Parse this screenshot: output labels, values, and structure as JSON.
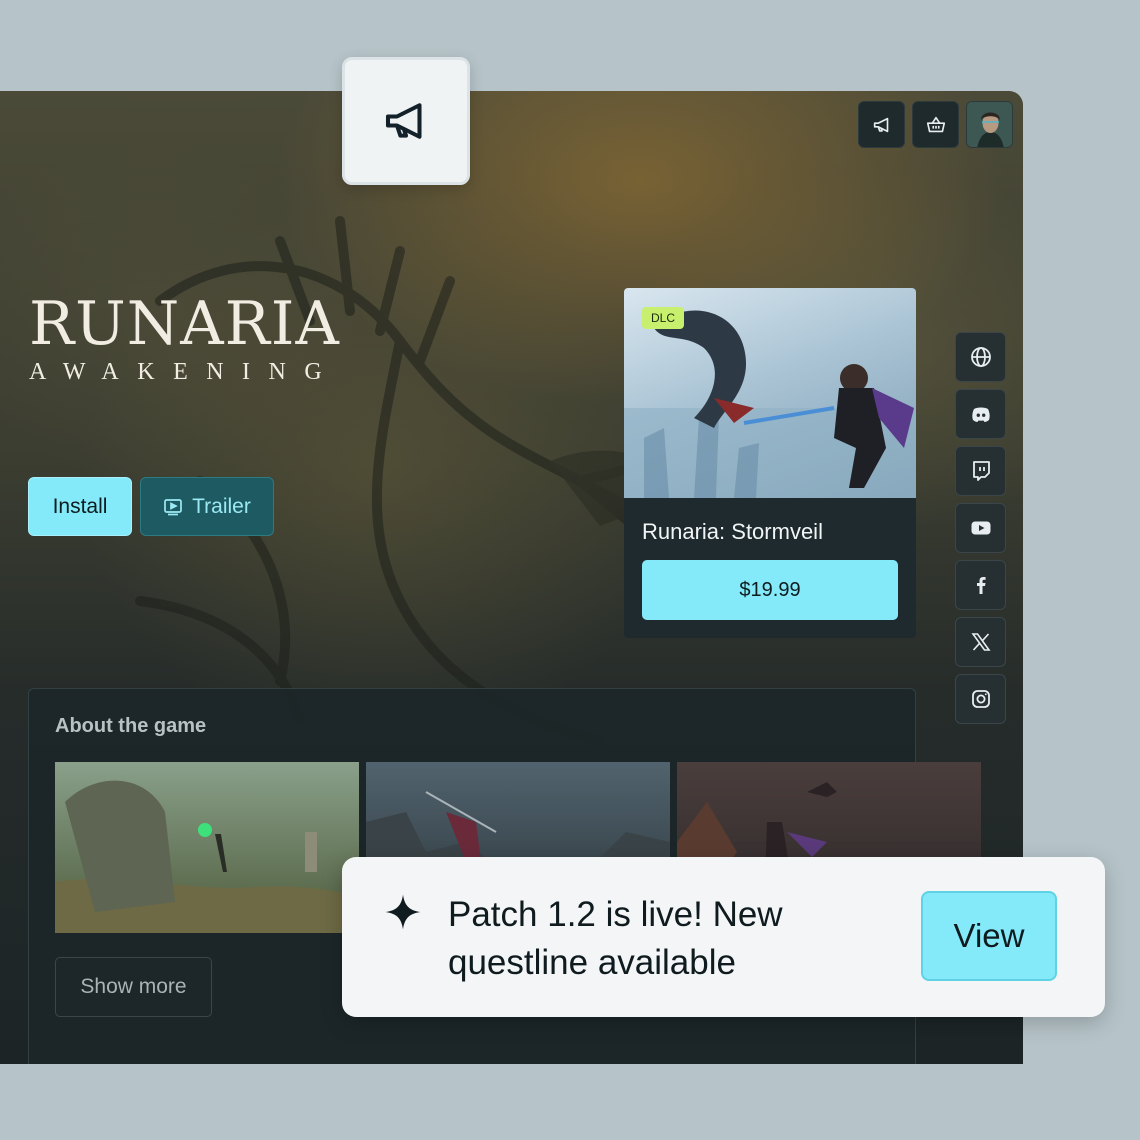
{
  "game": {
    "logo_title": "RUNARIA",
    "logo_subtitle": "AWAKENING"
  },
  "actions": {
    "install_label": "Install",
    "trailer_label": "Trailer"
  },
  "toolbar": {
    "items": [
      "megaphone-icon",
      "basket-icon",
      "user-avatar"
    ]
  },
  "dlc": {
    "badge": "DLC",
    "title": "Runaria: Stormveil",
    "price": "$19.99"
  },
  "social": {
    "items": [
      "globe-icon",
      "discord-icon",
      "twitch-icon",
      "youtube-icon",
      "facebook-icon",
      "x-icon",
      "instagram-icon"
    ]
  },
  "about": {
    "title": "About the game",
    "show_more_label": "Show more"
  },
  "toast": {
    "message": "Patch 1.2 is live! New questline available",
    "action_label": "View"
  },
  "colors": {
    "accent": "#84eaf9",
    "badge": "#c8f06e",
    "panel": "#1e2a2d"
  }
}
